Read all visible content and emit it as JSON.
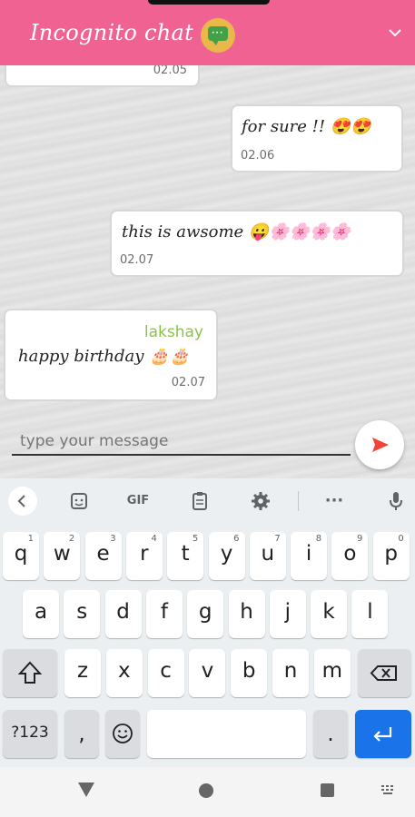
{
  "app_bar": {
    "title": "Incognito chat",
    "logo_icon": "chat-bubble-icon",
    "menu_icon": "chevron-down-icon",
    "color": "#f06292"
  },
  "messages": [
    {
      "text": "",
      "emoji": "",
      "time": "02.05",
      "side": "left",
      "sender": ""
    },
    {
      "text": "for sure !! ",
      "emoji": "😍😍",
      "time": "02.06",
      "side": "right",
      "sender": ""
    },
    {
      "text": "this is awsome ",
      "emoji": "😛🌸🌸🌸🌸",
      "time": "02.07",
      "side": "right",
      "sender": ""
    },
    {
      "text": "happy birthday ",
      "emoji": "🎂🎂",
      "time": "02.07",
      "side": "left",
      "sender": "lakshay"
    }
  ],
  "composer": {
    "placeholder": "type your message",
    "send_icon": "send-icon",
    "send_color": "#f44336"
  },
  "keyboard": {
    "toolbar": {
      "back_icon": "chevron-left-icon",
      "sticker_icon": "sticker-icon",
      "gif": "GIF",
      "clipboard_icon": "clipboard-icon",
      "settings_icon": "gear-icon",
      "more": "···",
      "mic_icon": "microphone-icon"
    },
    "row1": [
      {
        "key": "q",
        "hint": "1"
      },
      {
        "key": "w",
        "hint": "2"
      },
      {
        "key": "e",
        "hint": "3"
      },
      {
        "key": "r",
        "hint": "4"
      },
      {
        "key": "t",
        "hint": "5"
      },
      {
        "key": "y",
        "hint": "6"
      },
      {
        "key": "u",
        "hint": "7"
      },
      {
        "key": "i",
        "hint": "8"
      },
      {
        "key": "o",
        "hint": "9"
      },
      {
        "key": "p",
        "hint": "0"
      }
    ],
    "row2": [
      "a",
      "s",
      "d",
      "f",
      "g",
      "h",
      "j",
      "k",
      "l"
    ],
    "row3": [
      "z",
      "x",
      "c",
      "v",
      "b",
      "n",
      "m"
    ],
    "shift_icon": "shift-icon",
    "backspace_icon": "backspace-icon",
    "symbols": "?123",
    "comma": ",",
    "emoji_icon": "emoji-icon",
    "period": ".",
    "enter_icon": "enter-icon",
    "accent": "#1a73e8"
  },
  "nav": {
    "back_icon": "back-triangle-icon",
    "home_icon": "home-circle-icon",
    "recents_icon": "recents-square-icon",
    "grip_icon": "keyboard-grip-icon"
  }
}
